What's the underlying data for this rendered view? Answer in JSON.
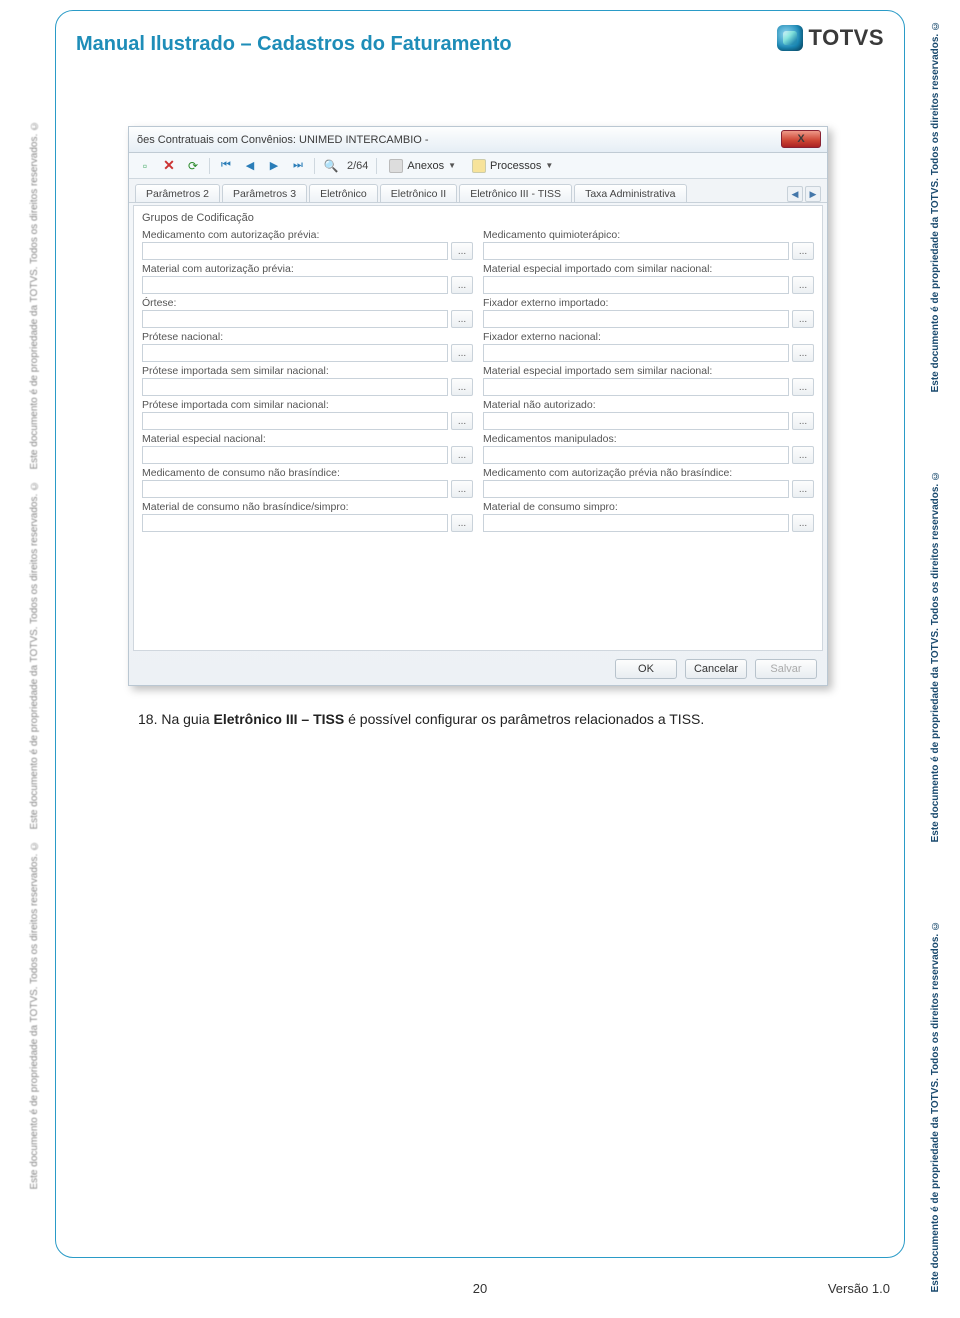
{
  "sideNotice": "Este documento é de propriedade da TOTVS. Todos os direitos reservados. ©",
  "header": {
    "title": "Manual Ilustrado – Cadastros do Faturamento",
    "logoText": "TOTVS"
  },
  "screenshot": {
    "windowTitle": "ões Contratuais com Convênios: UNIMED INTERCAMBIO -",
    "closeLabel": "X",
    "toolbar": {
      "pageIndicator": "2/64",
      "anexosLabel": "Anexos",
      "processosLabel": "Processos"
    },
    "tabs": [
      "Parâmetros 2",
      "Parâmetros 3",
      "Eletrônico",
      "Eletrônico II",
      "Eletrônico III - TISS",
      "Taxa Administrativa"
    ],
    "selectedTabIndex": 1,
    "groupLabel": "Grupos de Codificação",
    "leftFields": [
      "Medicamento com autorização prévia:",
      "Material com autorização prévia:",
      "Órtese:",
      "Prótese nacional:",
      "Prótese importada sem similar nacional:",
      "Prótese importada com similar nacional:",
      "Material especial nacional:",
      "Medicamento de consumo não brasíndice:",
      "Material de consumo não brasíndice/simpro:"
    ],
    "rightFields": [
      "Medicamento quimioterápico:",
      "Material especial importado com similar nacional:",
      "Fixador externo importado:",
      "Fixador externo nacional:",
      "Material especial importado sem similar nacional:",
      "Material não autorizado:",
      "Medicamentos manipulados:",
      "Medicamento com autorização prévia não brasíndice:",
      "Material de consumo simpro:"
    ],
    "lookupBtn": "...",
    "buttons": {
      "ok": "OK",
      "cancel": "Cancelar",
      "save": "Salvar"
    }
  },
  "bodyText": {
    "num": "18.",
    "pre": "Na guia ",
    "bold": "Eletrônico III – TISS",
    "post": " é possível configurar os parâmetros relacionados a TISS."
  },
  "footer": {
    "page": "20",
    "version": "Versão 1.0"
  }
}
